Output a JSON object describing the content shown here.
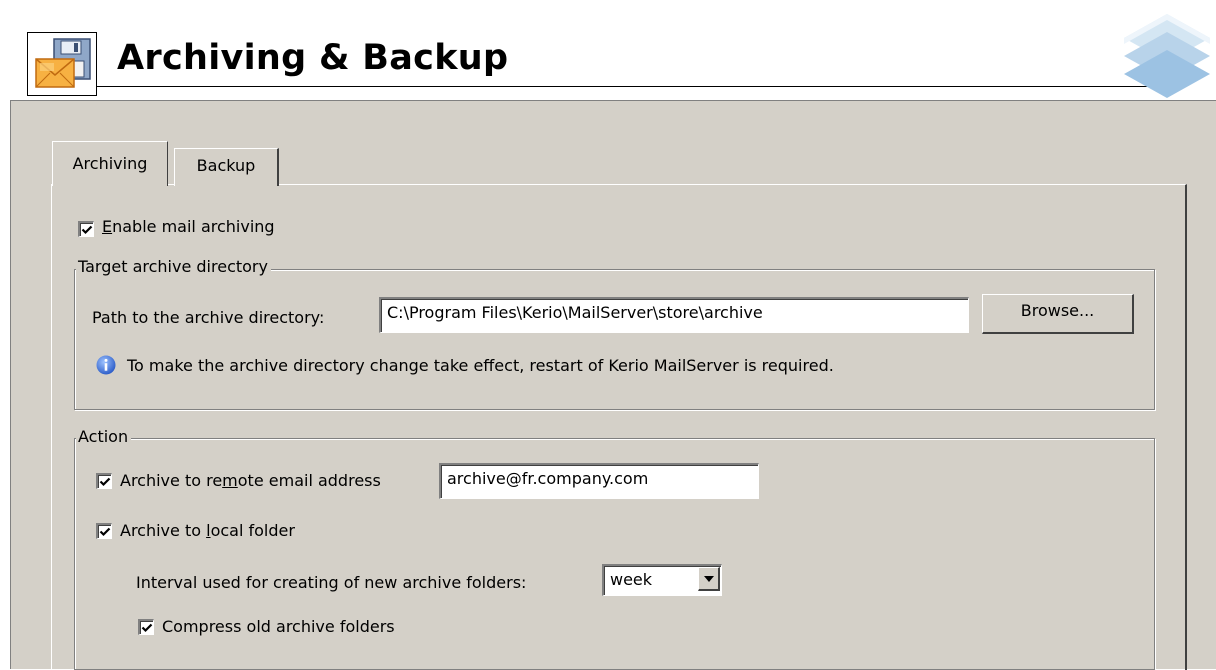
{
  "header": {
    "title": "Archiving & Backup",
    "app_icon": "archive-envelope-icon",
    "brand_logo": "kerio-logo"
  },
  "tabs": [
    {
      "label": "Archiving",
      "active": true
    },
    {
      "label": "Backup",
      "active": false
    }
  ],
  "archiving": {
    "enable_mail_archiving": {
      "prefix": "",
      "mnemonic": "E",
      "suffix": "nable mail archiving",
      "checked": true
    },
    "target_group": {
      "legend": "Target archive directory",
      "path_label": "Path to the archive directory:",
      "path_value": "C:\\Program Files\\Kerio\\MailServer\\store\\archive",
      "browse_label": "Browse...",
      "info_text": "To make the archive directory change take effect, restart of Kerio MailServer is required."
    },
    "action_group": {
      "legend": "Action",
      "remote": {
        "prefix": "Archive to re",
        "mnemonic": "m",
        "suffix": "ote email address",
        "checked": true,
        "value": "archive@fr.company.com"
      },
      "local": {
        "prefix": "Archive to ",
        "mnemonic": "l",
        "suffix": "ocal folder",
        "checked": true
      },
      "interval_label": "Interval used for creating of new archive folders:",
      "interval_value": "week",
      "compress": {
        "label": "Compress old archive folders",
        "checked": true
      }
    }
  },
  "colors": {
    "panel_bg": "#d4d0c8",
    "info_blue": "#3a6fd8"
  }
}
